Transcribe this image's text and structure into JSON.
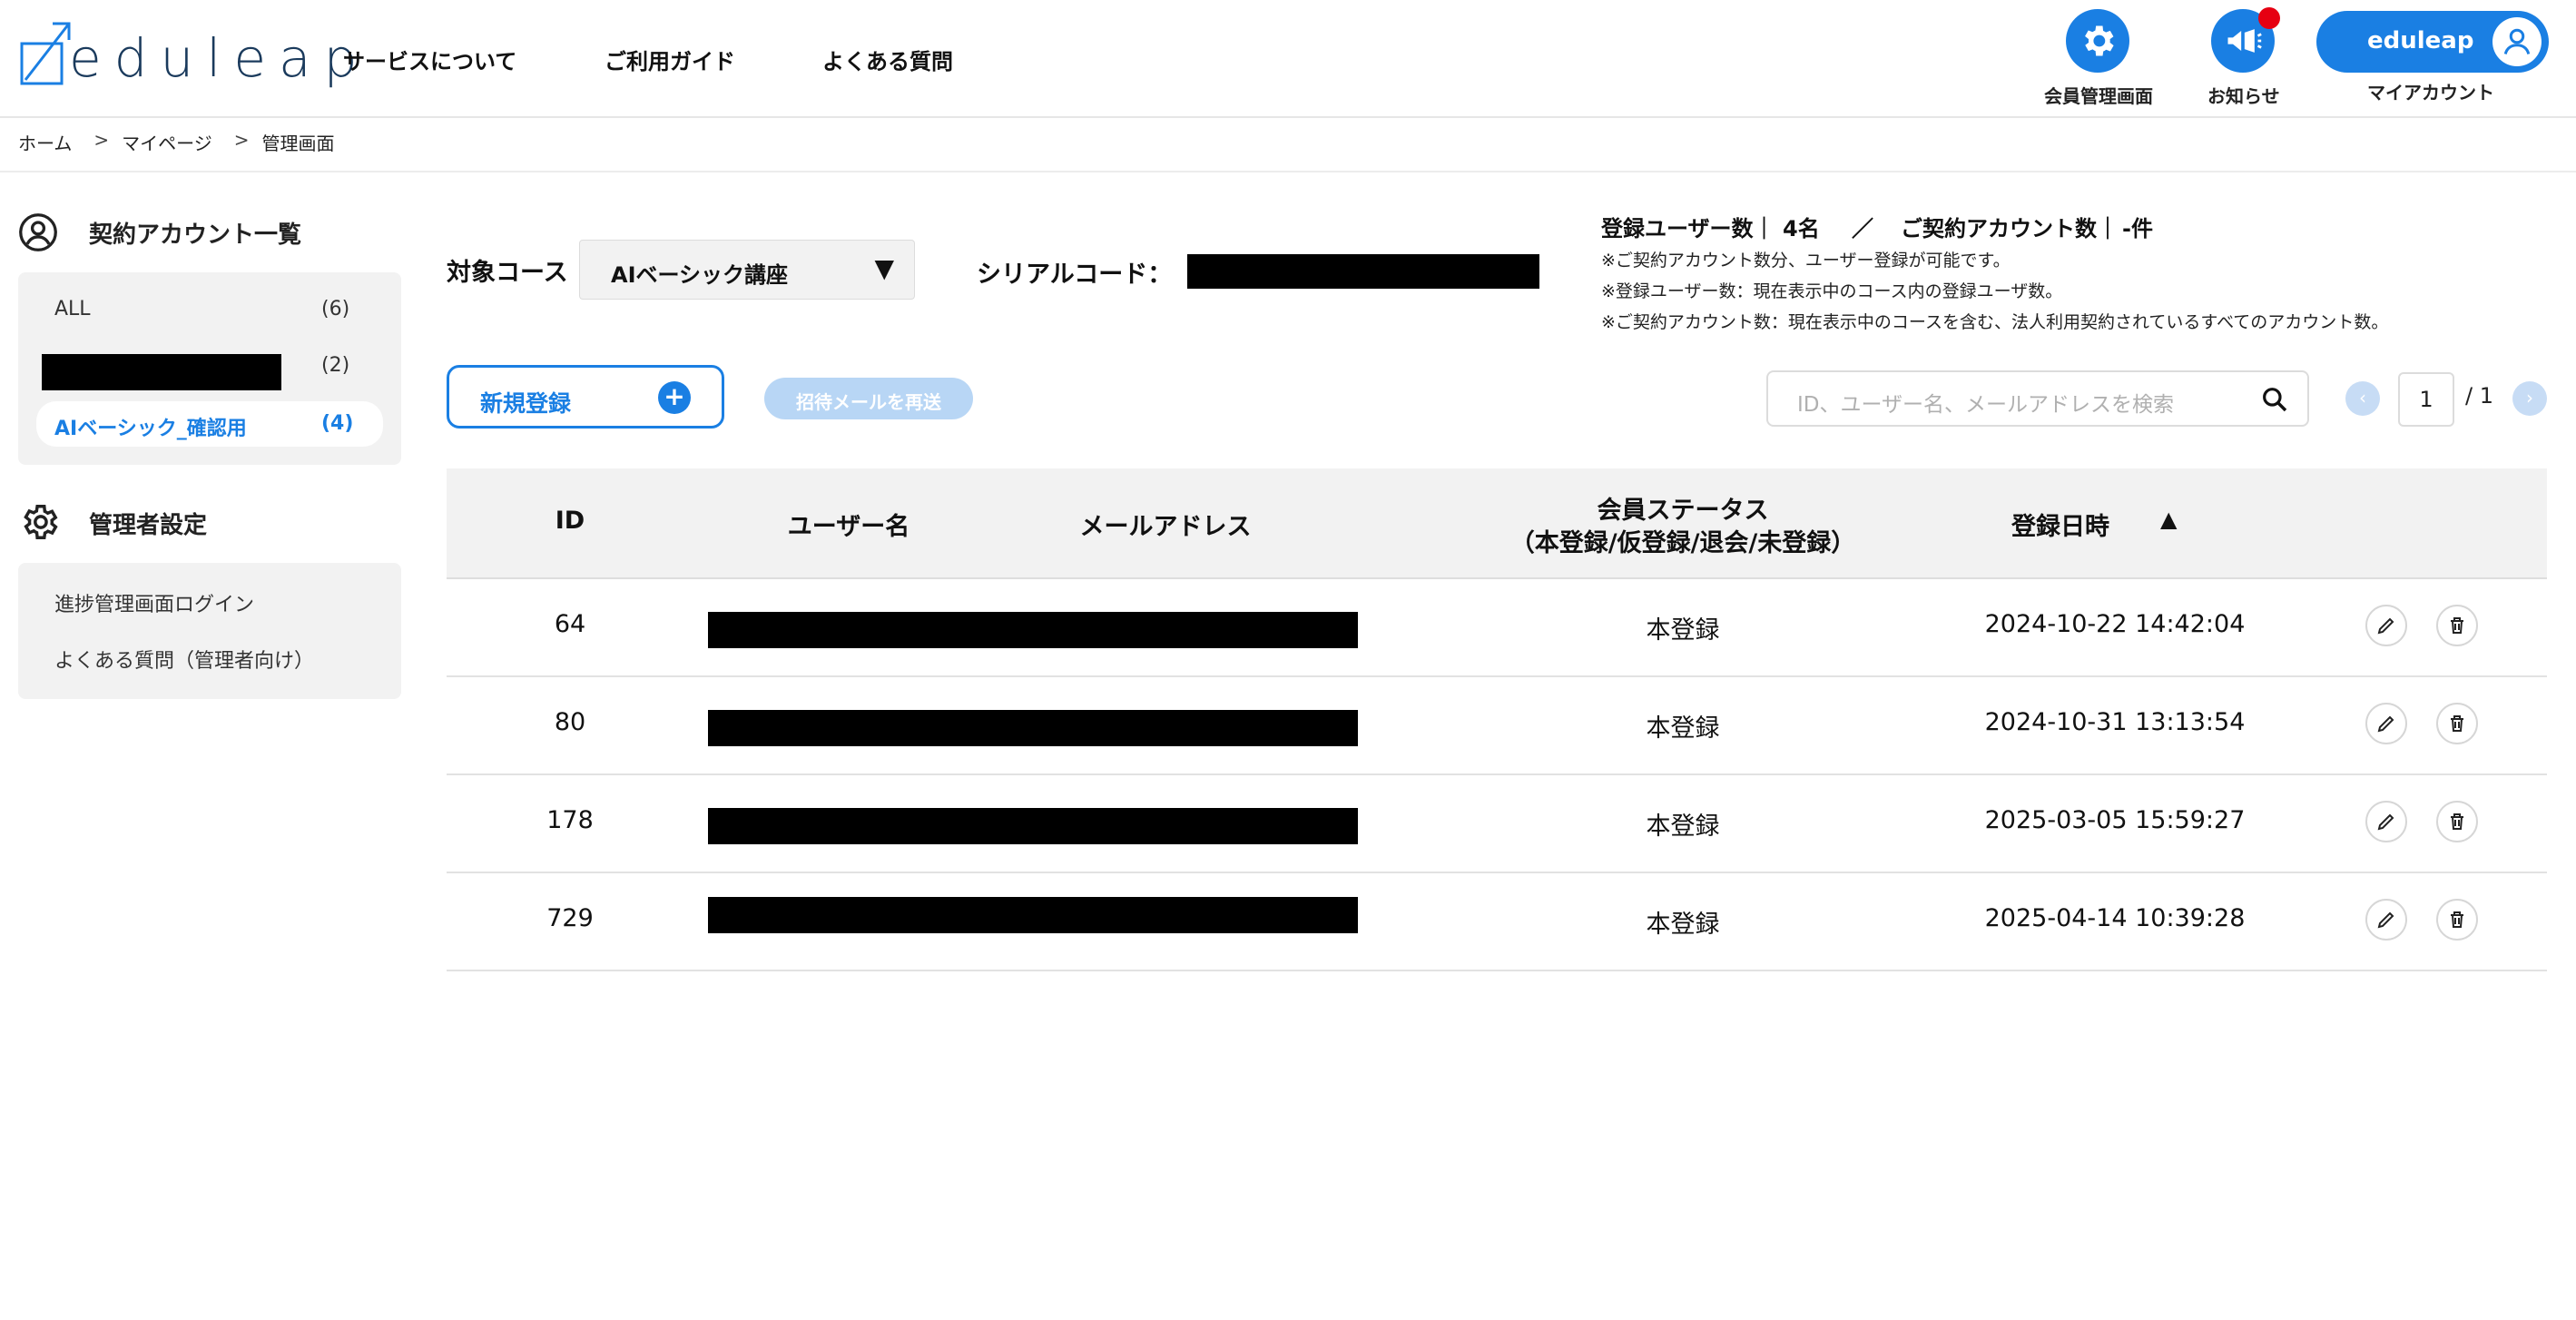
{
  "header": {
    "logo_text": "eduleap",
    "nav": [
      "サービスについて",
      "ご利用ガイド",
      "よくある質問"
    ],
    "member_admin_label": "会員管理画面",
    "notice_label": "お知らせ",
    "account_name": "eduleap",
    "my_account_label": "マイアカウント",
    "icons": {
      "member_admin": "gear-icon",
      "notice": "megaphone-icon",
      "account": "user-avatar-icon"
    },
    "accent_color": "#1a7fe3",
    "notice_badge_color": "#e60012"
  },
  "breadcrumb": [
    "ホーム",
    "マイページ",
    "管理画面"
  ],
  "sidebar": {
    "accounts_title": "契約アカウント一覧",
    "accounts": [
      {
        "label": "ALL",
        "count": "(6)"
      },
      {
        "label": "",
        "count": "(2)"
      },
      {
        "label": "AIベーシック_確認用",
        "count": "(4)"
      }
    ],
    "admin_title": "管理者設定",
    "admin_items": [
      "進捗管理画面ログイン",
      "よくある質問（管理者向け）"
    ]
  },
  "filter": {
    "course_label": "対象コース",
    "course_value": "AIベーシック講座",
    "serial_label": "シリアルコード：",
    "registered_users_label": "登録ユーザー数｜",
    "registered_users_value": "4名",
    "separator": "／",
    "contract_accounts_label": "ご契約アカウント数｜",
    "contract_accounts_value": "-件",
    "notes": [
      "※ご契約アカウント数分、ユーザー登録が可能です。",
      "※登録ユーザー数：現在表示中のコース内の登録ユーザ数。",
      "※ご契約アカウント数：現在表示中のコースを含む、法人利用契約されているすべてのアカウント数。"
    ]
  },
  "actions": {
    "new_label": "新規登録",
    "resend_label": "招待メールを再送",
    "search_placeholder": "ID、ユーザー名、メールアドレスを検索",
    "page_current": "1",
    "page_total": "/ 1"
  },
  "table": {
    "headers": {
      "id": "ID",
      "username": "ユーザー名",
      "email": "メールアドレス",
      "status_line1": "会員ステータス",
      "status_line2": "（本登録/仮登録/退会/未登録）",
      "date": "登録日時",
      "sort": "▲"
    },
    "rows": [
      {
        "id": "64",
        "status": "本登録",
        "date": "2024-10-22 14:42:04"
      },
      {
        "id": "80",
        "status": "本登録",
        "date": "2024-10-31 13:13:54"
      },
      {
        "id": "178",
        "status": "本登録",
        "date": "2025-03-05 15:59:27"
      },
      {
        "id": "729",
        "status": "本登録",
        "date": "2025-04-14 10:39:28"
      }
    ]
  }
}
